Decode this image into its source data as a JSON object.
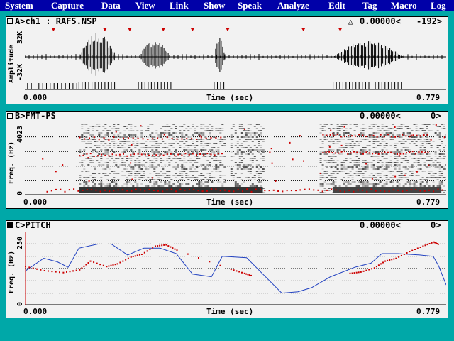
{
  "menu": [
    "System",
    "Capture",
    "Data",
    "View",
    "Link",
    "Show",
    "Speak",
    "Analyze",
    "Edit",
    "Tag",
    "Macro",
    "Log"
  ],
  "colors": {
    "background": "#00a8a8",
    "menubar": "#0000a8",
    "panel": "#f2f2f2",
    "marker": "#cc0000",
    "pitch_line": "#2040c0"
  },
  "panels": [
    {
      "id": "A",
      "title": "A>ch1 : RAF5.NSP",
      "value": "0.00000<",
      "value2": "-192>",
      "extra_icon": "triangle-outline-icon",
      "ylabel": "Amplitude",
      "ytop": "32K",
      "ybottom": "-32K",
      "xstart": "0.000",
      "xlabel": "Time (sec)",
      "xend": "0.779",
      "selected": false
    },
    {
      "id": "B",
      "title": "B>FMT-PS",
      "value": "0.00000<",
      "value2": "0>",
      "ylabel": "Freq. (Hz)",
      "ytop": "4023",
      "ybottom": "0",
      "xstart": "0.000",
      "xlabel": "Time (sec)",
      "xend": "0.779",
      "selected": false
    },
    {
      "id": "C",
      "title": "C>PITCH",
      "value": "0.00000<",
      "value2": "0>",
      "ylabel": "Freq. (Hz)",
      "ytop": "250",
      "ybottom": "0",
      "xstart": "0.000",
      "xlabel": "Time (sec)",
      "xend": "0.779",
      "selected": true
    }
  ],
  "chart_data": [
    {
      "type": "line",
      "panel": "A",
      "x": [
        0.0,
        0.779
      ],
      "ylim": [
        -32768,
        32767
      ],
      "voiced_segments": [
        [
          0.1,
          0.17
        ],
        [
          0.21,
          0.27
        ],
        [
          0.35,
          0.37
        ],
        [
          0.57,
          0.7
        ]
      ],
      "peak_markers": [
        0.053,
        0.148,
        0.194,
        0.256,
        0.31,
        0.375,
        0.515,
        0.583
      ]
    },
    {
      "type": "scatter",
      "panel": "B",
      "x": [
        0.0,
        0.779
      ],
      "ylim": [
        0,
        4023
      ]
    },
    {
      "type": "line",
      "panel": "C",
      "x": [
        0.0,
        0.779
      ],
      "ylim": [
        0,
        250
      ],
      "series": [
        {
          "values": [
            [
              0.0,
              120
            ],
            [
              0.035,
              168
            ],
            [
              0.06,
              155
            ],
            [
              0.08,
              135
            ],
            [
              0.1,
              205
            ],
            [
              0.135,
              220
            ],
            [
              0.16,
              220
            ],
            [
              0.19,
              180
            ],
            [
              0.22,
              205
            ],
            [
              0.25,
              205
            ],
            [
              0.28,
              185
            ],
            [
              0.31,
              110
            ],
            [
              0.345,
              100
            ],
            [
              0.365,
              175
            ],
            [
              0.41,
              170
            ],
            [
              0.44,
              110
            ],
            [
              0.475,
              40
            ],
            [
              0.505,
              45
            ],
            [
              0.53,
              60
            ],
            [
              0.565,
              100
            ],
            [
              0.61,
              135
            ],
            [
              0.64,
              150
            ],
            [
              0.66,
              185
            ],
            [
              0.69,
              185
            ],
            [
              0.73,
              180
            ],
            [
              0.755,
              175
            ],
            [
              0.765,
              140
            ],
            [
              0.779,
              70
            ]
          ]
        },
        {
          "values": [
            [
              0.0,
              140
            ],
            [
              0.035,
              125
            ],
            [
              0.07,
              118
            ],
            [
              0.1,
              128
            ],
            [
              0.12,
              160
            ],
            [
              0.15,
              140
            ],
            [
              0.17,
              150
            ],
            [
              0.195,
              175
            ],
            [
              0.215,
              185
            ],
            [
              0.24,
              215
            ],
            [
              0.26,
              220
            ],
            [
              0.28,
              200
            ],
            [
              0.38,
              130
            ],
            [
              0.405,
              115
            ],
            [
              0.42,
              105
            ],
            [
              0.6,
              115
            ],
            [
              0.62,
              120
            ],
            [
              0.645,
              135
            ],
            [
              0.665,
              160
            ],
            [
              0.685,
              170
            ],
            [
              0.71,
              195
            ],
            [
              0.735,
              215
            ],
            [
              0.755,
              230
            ],
            [
              0.765,
              220
            ]
          ]
        }
      ]
    }
  ]
}
